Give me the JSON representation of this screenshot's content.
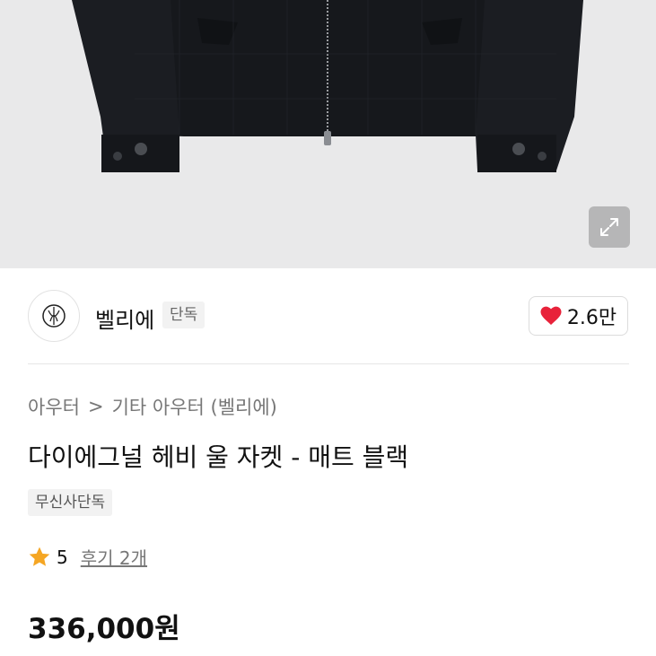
{
  "product_image": {
    "zoom_icon": "expand-icon"
  },
  "brand": {
    "name": "벨리에",
    "badge": "단독",
    "logo_icon": "brand-logo-icon"
  },
  "like": {
    "icon": "heart-icon",
    "count": "2.6만",
    "color": "#e8223a"
  },
  "breadcrumb": {
    "items": [
      "아우터",
      "기타 아우터 (벨리에)"
    ],
    "separator": ">"
  },
  "product": {
    "title": "다이에그널 헤비 울 자켓 - 매트 블랙",
    "tag": "무신사단독",
    "rating": "5",
    "review_label": "후기 2개",
    "price": "336,000원"
  },
  "colors": {
    "star": "#f5a623",
    "heart": "#e8223a"
  }
}
